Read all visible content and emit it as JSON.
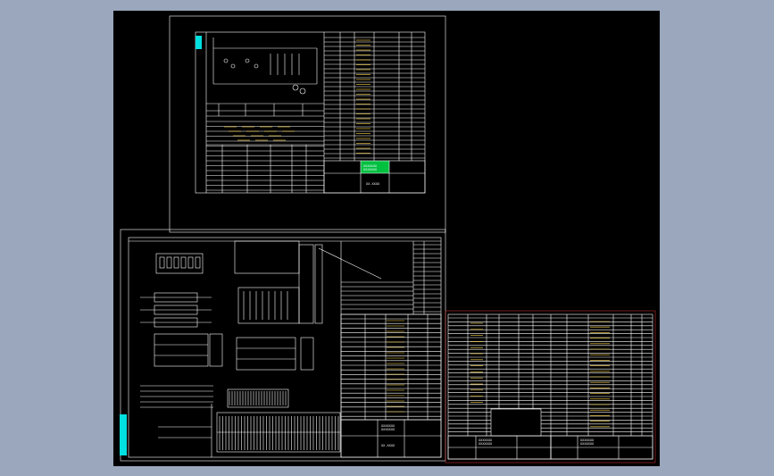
{
  "app": {
    "accent": "#9aa7bd",
    "canvas_background": "#000000",
    "line_color": "#ffffff",
    "highlight_color": "#00e0e0",
    "green_box_color": "#00c040",
    "red_border_color": "#c03030"
  },
  "sheets": {
    "top": {
      "title_block": {
        "company": "XXXXXXX",
        "project": "XXXXXXX",
        "code": "XX-XXXX"
      }
    },
    "bottom_left": {
      "title_block": {
        "company": "XXXXXXX",
        "project": "XXXXXXX",
        "code": "XX-XXXX"
      }
    },
    "right": {
      "title_blocks": [
        {
          "company": "XXXXXXX",
          "project": "XXXXXXX"
        },
        {
          "company": "XXXXXXX",
          "project": "XXXXXXX"
        }
      ]
    }
  }
}
